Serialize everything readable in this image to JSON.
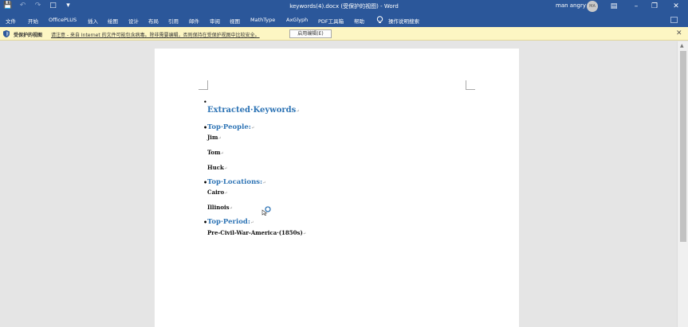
{
  "titlebar": {
    "title": "keywords(4).docx (受保护的视图) - Word",
    "user_name": "man angry",
    "avatar_initials": "MA",
    "qat_icons": [
      "save-icon",
      "undo-icon",
      "redo-icon",
      "print-preview-icon",
      "customize-icon"
    ],
    "window_buttons": [
      "ribbon-display-icon",
      "minimize-icon",
      "restore-icon",
      "close-icon"
    ]
  },
  "ribbon": {
    "tabs": [
      "文件",
      "开始",
      "OfficePLUS",
      "插入",
      "绘图",
      "设计",
      "布局",
      "引用",
      "邮件",
      "审阅",
      "视图",
      "MathType",
      "AxGlyph",
      "PDF工具箱",
      "帮助"
    ],
    "tell_me": "操作说明搜索"
  },
  "protected_view": {
    "title": "受保护的视图",
    "message": "请注意 - 来自 Internet 的文件可能包含病毒。除非需要编辑，否则保持在受保护视图中比较安全。",
    "button": "启用编辑(E)"
  },
  "document": {
    "heading": "Extracted·Keywords",
    "sections": [
      {
        "title": "Top·People:",
        "items": [
          "Jim",
          "Tom",
          "Huck"
        ]
      },
      {
        "title": "Top·Locations:",
        "items": [
          "Cairo",
          "Illinois"
        ]
      },
      {
        "title": "Top·Period:",
        "items": [
          "Pre-Civil-War-America·(1850s)"
        ]
      }
    ],
    "paragraph_mark": "↵"
  },
  "colors": {
    "title_bar": "#2b579a",
    "heading": "#2e74b5",
    "protected_bar": "#fdf6c3"
  }
}
